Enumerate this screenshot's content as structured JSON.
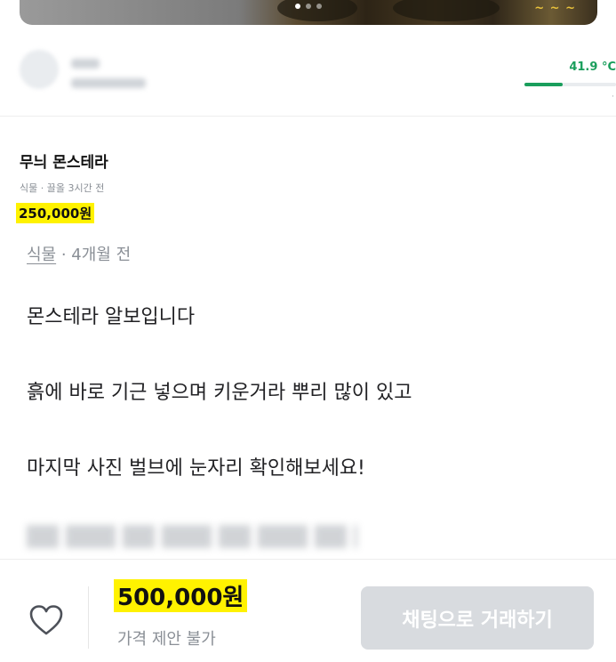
{
  "listing_card": {
    "title": "무늬 몬스테라",
    "meta": "식물 · 끌올 3시간 전",
    "price": "250,000원"
  },
  "seller": {
    "temperature": "41.9 °C",
    "temperature_level": 0.42
  },
  "detail": {
    "category": "식물",
    "age": " · 4개월 전",
    "description": [
      "몬스테라 알보입니다",
      "흙에 바로 기근 넣으며 키운거라 뿌리 많이 있고",
      "마지막 사진 벌브에 눈자리 확인해보세요!"
    ]
  },
  "bottom_bar": {
    "price": "500,000원",
    "negotiation": "가격 제안 불가",
    "chat_button": "채팅으로 거래하기"
  },
  "colors": {
    "highlight": "#fff200",
    "manner_green": "#1a9e5c",
    "button_disabled": "#d8dbdf"
  },
  "icons": [
    "heart-icon"
  ]
}
